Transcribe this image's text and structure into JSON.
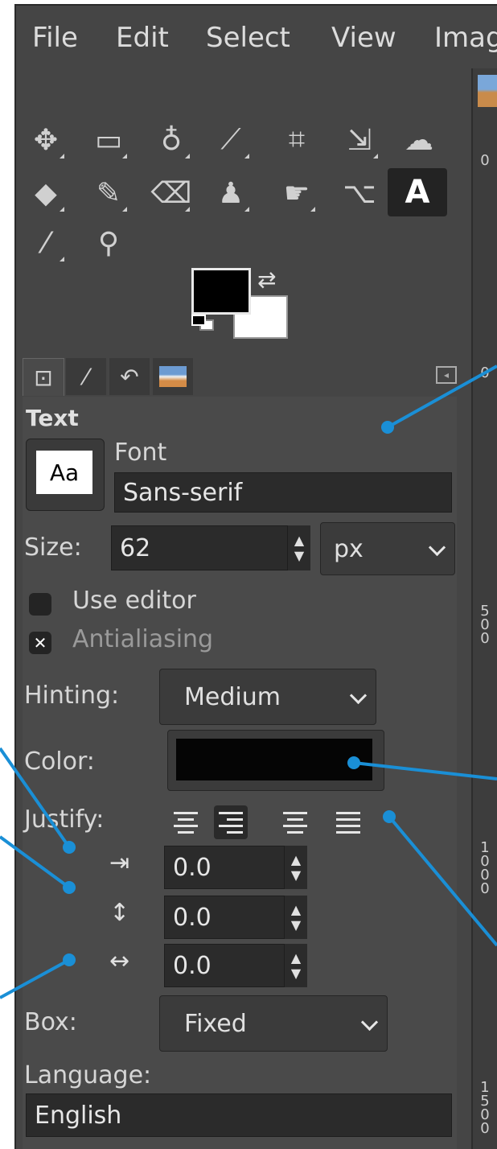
{
  "menubar": {
    "items": [
      "File",
      "Edit",
      "Select",
      "View",
      "Imag"
    ]
  },
  "toolbox": {
    "tools": [
      "move-icon",
      "rect-select-icon",
      "lasso-icon",
      "fuzzy-select-icon",
      "crop-icon",
      "unified-transform-icon",
      "warp-icon",
      "bucket-fill-icon",
      "paintbrush-icon",
      "eraser-icon",
      "clone-icon",
      "smudge-icon",
      "paths-icon",
      "text-tool-icon",
      "color-picker-icon",
      "zoom-icon"
    ],
    "active_tool_label": "A",
    "fg_color": "#000000",
    "bg_color": "#ffffff"
  },
  "tabs": [
    "tool-options",
    "device-status",
    "undo-history",
    "images"
  ],
  "text_options": {
    "title": "Text",
    "font_label": "Font",
    "font_preview": "Aa",
    "font_value": "Sans-serif",
    "size_label": "Size:",
    "size_value": "62",
    "unit_value": "px",
    "use_editor_label": "Use editor",
    "use_editor_checked": false,
    "antialiasing_label": "Antialiasing",
    "antialiasing_checked": true,
    "antialiasing_mark": "✕",
    "hinting_label": "Hinting:",
    "hinting_value": "Medium",
    "color_label": "Color:",
    "color_value": "#050505",
    "justify_label": "Justify:",
    "justify_options": [
      "left",
      "right",
      "center",
      "fill"
    ],
    "justify_active": "right",
    "indent_value": "0.0",
    "line_spacing_value": "0.0",
    "letter_spacing_value": "0.0",
    "box_label": "Box:",
    "box_value": "Fixed",
    "language_label": "Language:",
    "language_value": "English"
  },
  "ruler": {
    "marks": [
      "0",
      "0",
      "500",
      "1000",
      "1500"
    ]
  },
  "callout_color": "#1a8fd6"
}
